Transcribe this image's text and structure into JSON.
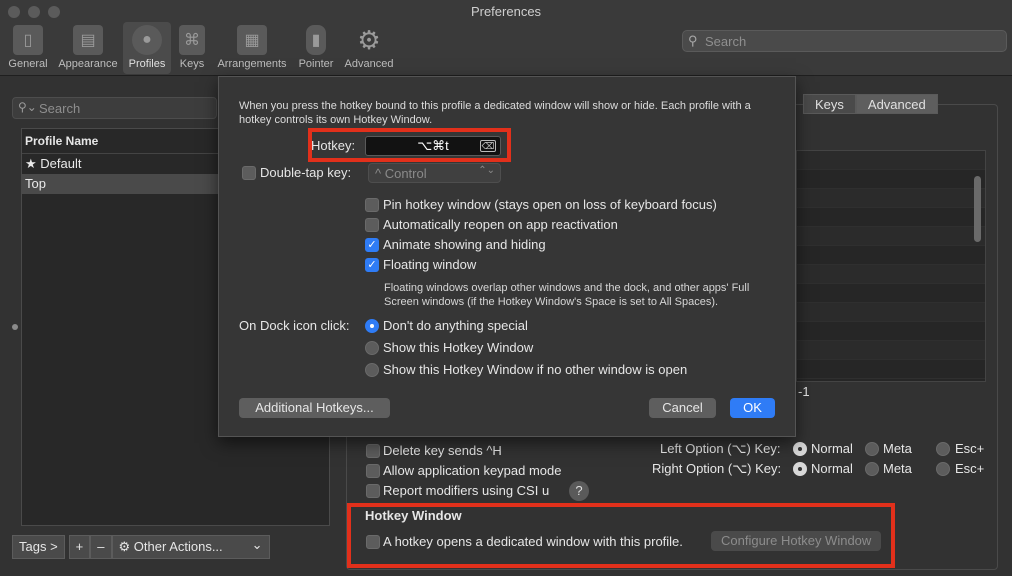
{
  "window": {
    "title": "Preferences"
  },
  "toolbar": {
    "items": [
      {
        "label": "General",
        "icon": "general-switch-icon"
      },
      {
        "label": "Appearance",
        "icon": "appearance-icon"
      },
      {
        "label": "Profiles",
        "icon": "profiles-person-icon"
      },
      {
        "label": "Keys",
        "icon": "keys-command-icon"
      },
      {
        "label": "Arrangements",
        "icon": "arrangements-icon"
      },
      {
        "label": "Pointer",
        "icon": "mouse-pointer-icon"
      },
      {
        "label": "Advanced",
        "icon": "gear-icon"
      }
    ],
    "search_placeholder": "Search"
  },
  "sidebar": {
    "search_placeholder": "Search",
    "column_header": "Profile Name",
    "profiles": [
      {
        "name": "Default",
        "star": "★"
      },
      {
        "name": "Top"
      }
    ],
    "tags_label": "Tags >",
    "add_label": "+",
    "remove_label": "–",
    "other_actions_label": "Other Actions...",
    "other_actions_arrow": "⌄"
  },
  "tabs": {
    "keys": "Keys",
    "advanced": "Advanced"
  },
  "background": {
    "partial_text": "-1",
    "delete_key": "Delete key sends ^H",
    "keypad_mode": "Allow application keypad mode",
    "report_modifiers": "Report modifiers using CSI u",
    "help": "?",
    "left_option": "Left Option (⌥) Key:",
    "right_option": "Right Option (⌥) Key:",
    "opt_normal": "Normal",
    "opt_meta": "Meta",
    "opt_esc": "Esc+",
    "hotkey_window_heading": "Hotkey Window",
    "hotkey_checkbox": "A hotkey opens a dedicated window with this profile.",
    "configure_button": "Configure Hotkey Window"
  },
  "sheet": {
    "intro": "When you press the hotkey bound to this profile a dedicated window will show or hide. Each profile with a hotkey controls its own Hotkey Window.",
    "hotkey_label": "Hotkey:",
    "hotkey_value": "⌥⌘t",
    "hotkey_clear": "⌫",
    "double_tap_label": "Double-tap key:",
    "double_tap_value": "^ Control",
    "double_tap_arrow": "⌃⌄",
    "pin": "Pin hotkey window (stays open on loss of keyboard focus)",
    "auto_reopen": "Automatically reopen on app reactivation",
    "animate": "Animate showing and hiding",
    "floating": "Floating window",
    "floating_note": "Floating windows overlap other windows and the dock, and other apps' Full Screen windows (if the Hotkey Window's Space is set to All Spaces).",
    "dock_label": "On Dock icon click:",
    "dock_opt1": "Don't do anything special",
    "dock_opt2": "Show this Hotkey Window",
    "dock_opt3": "Show this Hotkey Window if no other window is open",
    "additional_hotkeys": "Additional Hotkeys...",
    "cancel": "Cancel",
    "ok": "OK",
    "check": "✓"
  },
  "colors": {
    "accent": "#2f7cf6",
    "highlight_box": "#e2301b"
  }
}
